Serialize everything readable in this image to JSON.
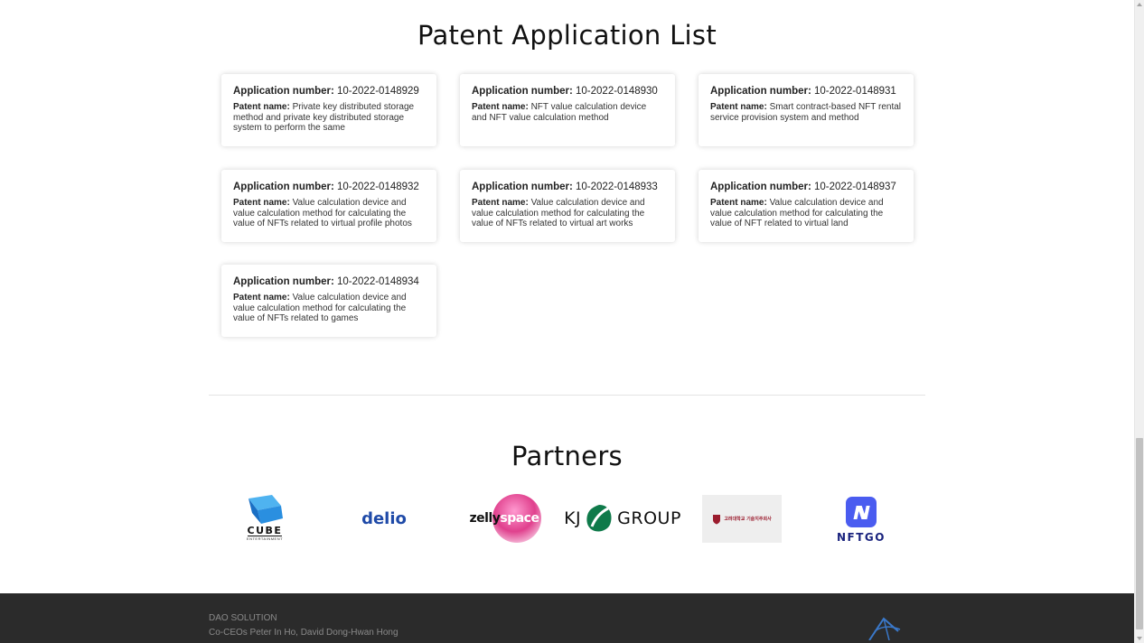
{
  "patents": {
    "title": "Patent Application List",
    "app_label": "Application number:",
    "name_label": "Patent name:",
    "items": [
      {
        "number": "10-2022-0148929",
        "name": "Private key distributed storage method and private key distributed storage system to perform the same"
      },
      {
        "number": "10-2022-0148930",
        "name": "NFT value calculation device and NFT value calculation method"
      },
      {
        "number": "10-2022-0148931",
        "name": "Smart contract-based NFT rental service provision system and method"
      },
      {
        "number": "10-2022-0148932",
        "name": "Value calculation device and value calculation method for calculating the value of NFTs related to virtual profile photos"
      },
      {
        "number": "10-2022-0148933",
        "name": "Value calculation device and value calculation method for calculating the value of NFTs related to virtual art works"
      },
      {
        "number": "10-2022-0148937",
        "name": "Value calculation device and value calculation method for calculating the value of NFT related to virtual land"
      },
      {
        "number": "10-2022-0148934",
        "name": "Value calculation device and value calculation method for calculating the value of NFTs related to games"
      }
    ]
  },
  "partners": {
    "title": "Partners",
    "logos": {
      "cube": "CUBE",
      "cube_sub": "ENTERTAINMENT",
      "delio": "delio",
      "zelly_a": "zelly",
      "zelly_b": "space",
      "kj_a": "KJ",
      "kj_b": "GROUP",
      "korea_univ": "고려대학교 기술지주회사",
      "nftgo": "NFTGO"
    }
  },
  "footer": {
    "company": "DAO SOLUTION",
    "ceos": "Co-CEOs Peter In Ho, David Dong-Hwan Hong"
  },
  "colors": {
    "footer_bg": "#2b2b2b",
    "delio_blue": "#1f4aa8",
    "zelly_pink": "#e0408d",
    "kj_green": "#0f7a4a",
    "nftgo_blue": "#4a5cf0",
    "nftgo_text": "#1a237e"
  }
}
